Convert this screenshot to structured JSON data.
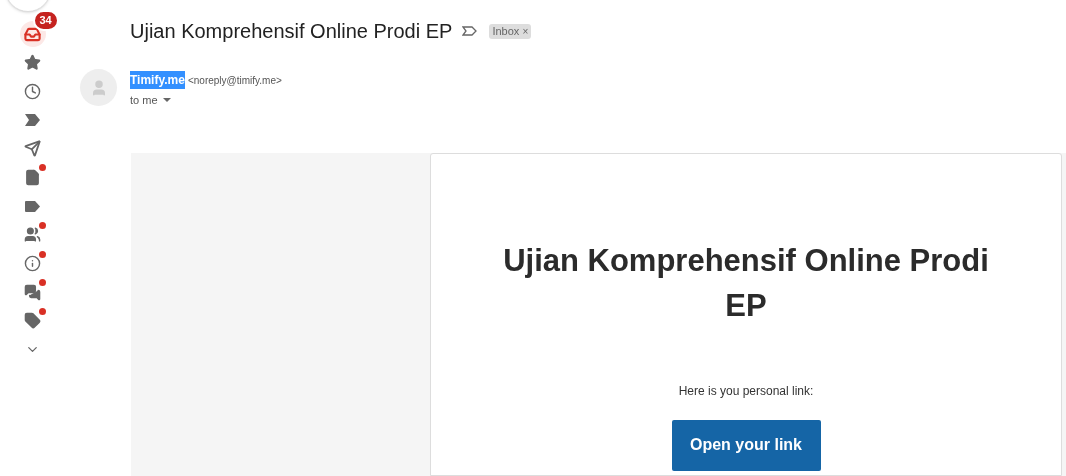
{
  "sidebar": {
    "items": [
      {
        "kind": "inbox",
        "selected": true,
        "badge": "34",
        "dot": false
      },
      {
        "kind": "star",
        "selected": false,
        "dot": false
      },
      {
        "kind": "clock",
        "selected": false,
        "dot": false
      },
      {
        "kind": "important",
        "selected": false,
        "dot": false
      },
      {
        "kind": "send",
        "selected": false,
        "dot": false
      },
      {
        "kind": "file",
        "selected": false,
        "dot": true
      },
      {
        "kind": "label",
        "selected": false,
        "dot": false
      },
      {
        "kind": "people",
        "selected": false,
        "dot": true
      },
      {
        "kind": "info",
        "selected": false,
        "dot": true
      },
      {
        "kind": "forum",
        "selected": false,
        "dot": true
      },
      {
        "kind": "tag",
        "selected": false,
        "dot": true
      },
      {
        "kind": "more",
        "selected": false,
        "dot": false
      }
    ]
  },
  "email": {
    "subject": "Ujian Komprehensif Online Prodi EP",
    "label": "Inbox",
    "label_close": "×",
    "sender_name": "Timify.me",
    "sender_selected": true,
    "sender_email": "<noreply@timify.me>",
    "recipient": "to me"
  },
  "message": {
    "heading": "Ujian Komprehensif Online Prodi EP",
    "text": "Here is you personal link:",
    "button": "Open your link"
  }
}
